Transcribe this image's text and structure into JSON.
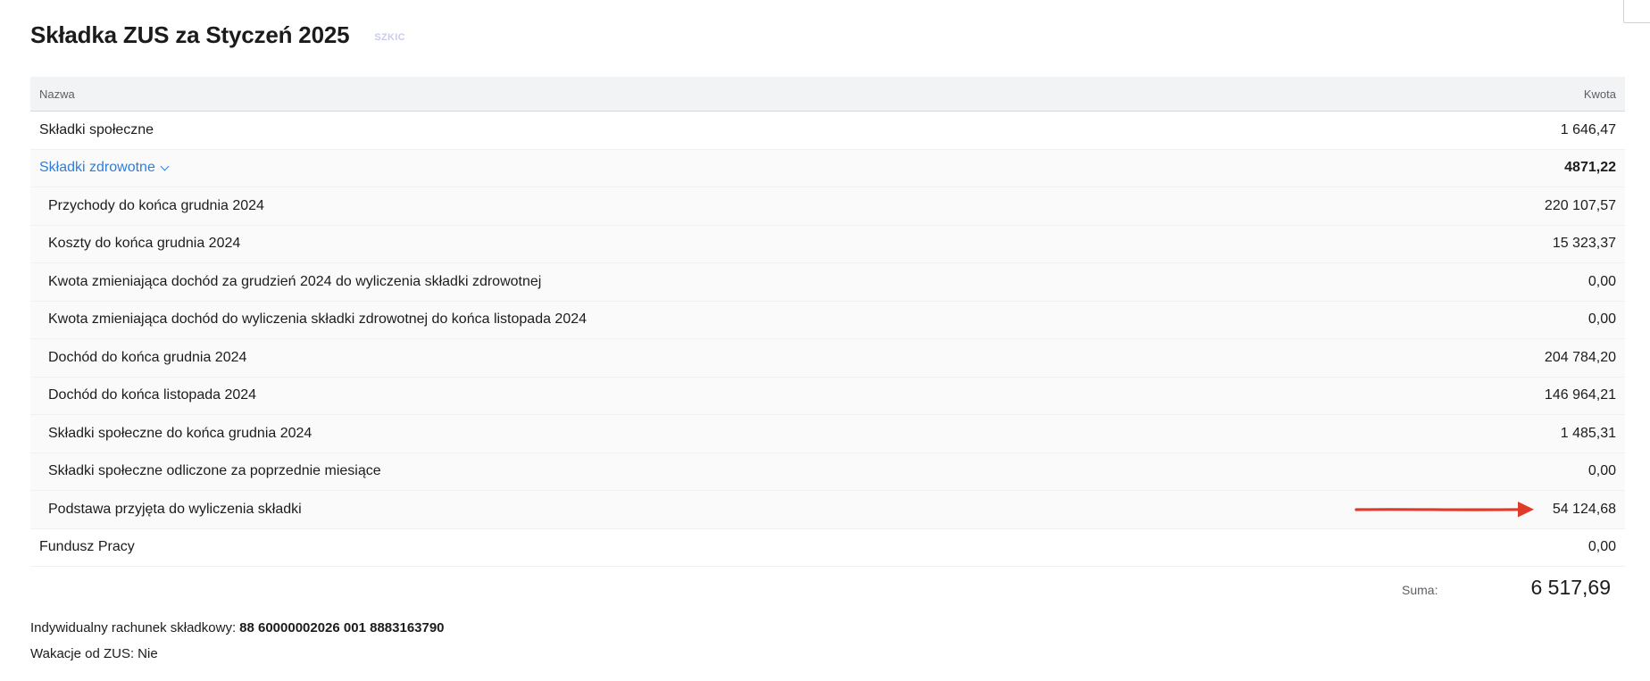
{
  "header": {
    "title": "Składka ZUS za Styczeń 2025",
    "status_badge": "SZKIC"
  },
  "table": {
    "col_name": "Nazwa",
    "col_amount": "Kwota",
    "rows": [
      {
        "label": "Składki społeczne",
        "amount": "1 646,47"
      },
      {
        "label": "Składki zdrowotne",
        "amount": "4871,22"
      },
      {
        "label": "Przychody do końca grudnia 2024",
        "amount": "220 107,57"
      },
      {
        "label": "Koszty do końca grudnia 2024",
        "amount": "15 323,37"
      },
      {
        "label": "Kwota zmieniająca dochód za grudzień 2024 do wyliczenia składki zdrowotnej",
        "amount": "0,00"
      },
      {
        "label": "Kwota zmieniająca dochód do wyliczenia składki zdrowotnej do końca listopada 2024",
        "amount": "0,00"
      },
      {
        "label": "Dochód do końca grudnia 2024",
        "amount": "204 784,20"
      },
      {
        "label": "Dochód do końca listopada 2024",
        "amount": "146 964,21"
      },
      {
        "label": "Składki społeczne do końca grudnia 2024",
        "amount": "1 485,31"
      },
      {
        "label": "Składki społeczne odliczone za poprzednie miesiące",
        "amount": "0,00"
      },
      {
        "label": "Podstawa przyjęta do wyliczenia składki",
        "amount": "54 124,68"
      },
      {
        "label": "Fundusz Pracy",
        "amount": "0,00"
      }
    ]
  },
  "summary": {
    "label": "Suma:",
    "value": "6 517,69"
  },
  "info": {
    "account_label": "Indywidualny rachunek składkowy:",
    "account_number": "88 60000002026 001 8883163790",
    "holiday_label": "Wakacje od ZUS:",
    "holiday_value": "Nie"
  },
  "icons": {
    "expand": "chevron-down-icon",
    "annotation": "red-arrow-annotation"
  },
  "colors": {
    "link_blue": "#2f7ed8",
    "arrow_red": "#e03a2a",
    "badge": "#c9ccef"
  }
}
